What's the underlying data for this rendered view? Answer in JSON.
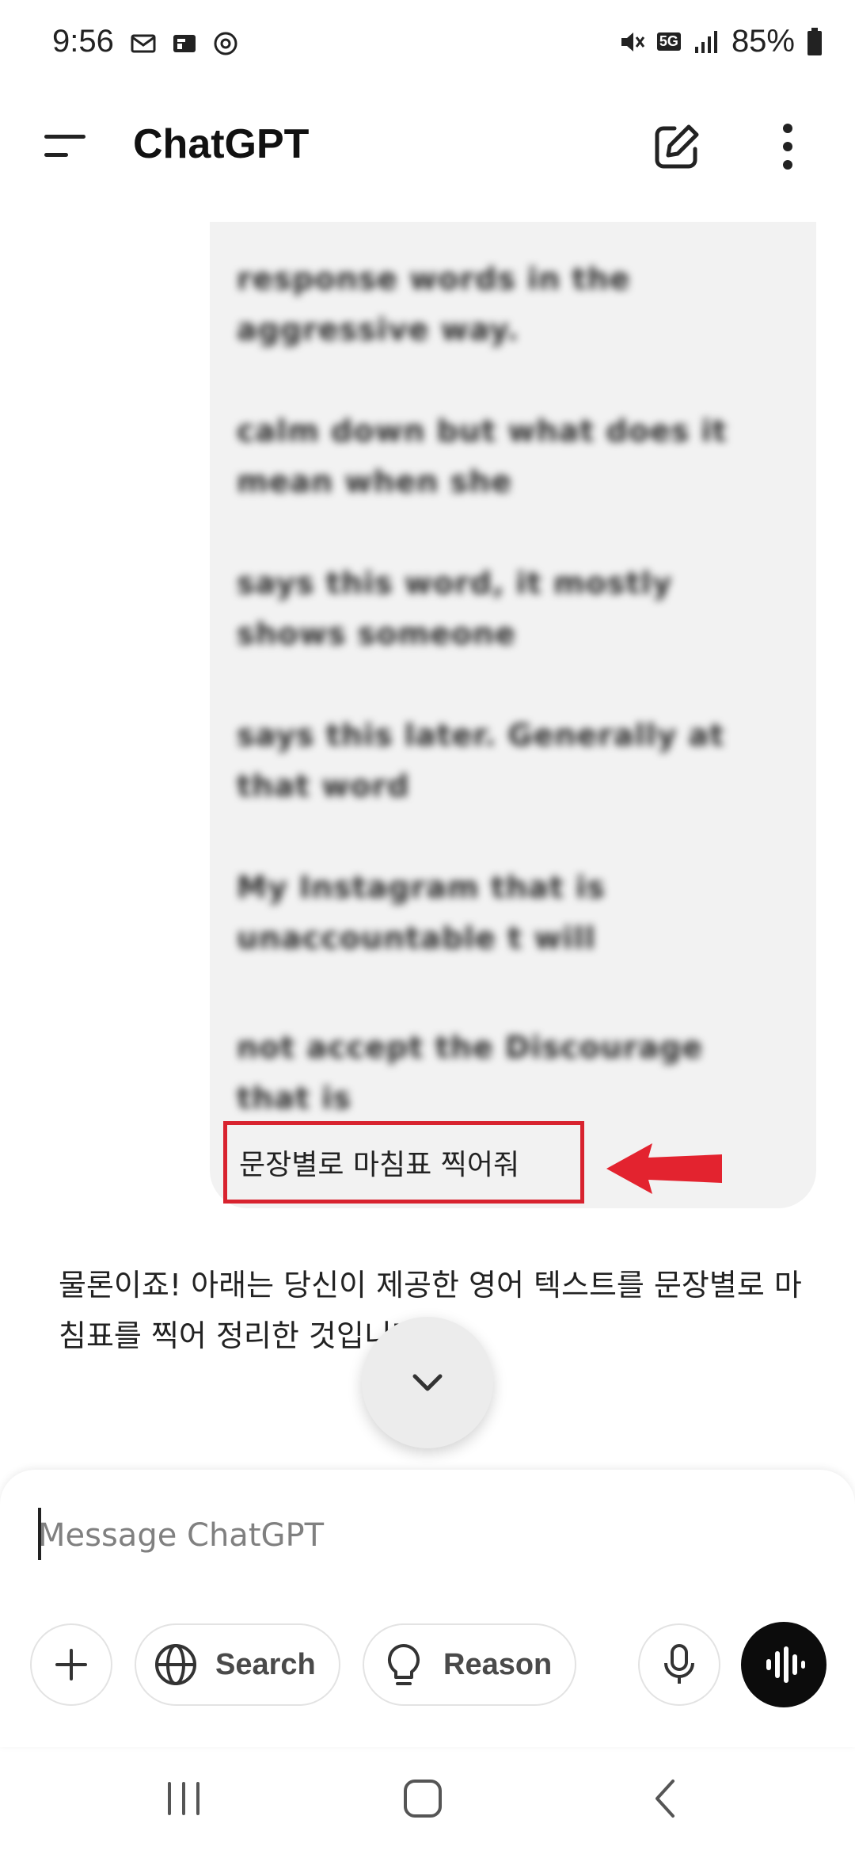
{
  "status_bar": {
    "time": "9:56",
    "network": "5G",
    "battery": "85%"
  },
  "header": {
    "title": "ChatGPT"
  },
  "conversation": {
    "user_message_lines": [
      "response words in the aggressive way.",
      "calm down but what does it mean when she",
      "says this word, it mostly shows someone",
      "says this later. Generally at that word",
      "My Instagram that is unaccountable t will",
      "not accept the Discourage that is"
    ],
    "user_last_line": "문장별로 마침표 찍어줘",
    "assistant_message": "물론이죠! 아래는 당신이 제공한 영어 텍스트를 문장별로 마침표를 찍어 정리한 것입니다:"
  },
  "composer": {
    "placeholder": "Message ChatGPT",
    "search_label": "Search",
    "reason_label": "Reason"
  },
  "colors": {
    "highlight": "#d8232f",
    "bubble": "#f2f2f2",
    "voice_button": "#0c0c0c"
  }
}
